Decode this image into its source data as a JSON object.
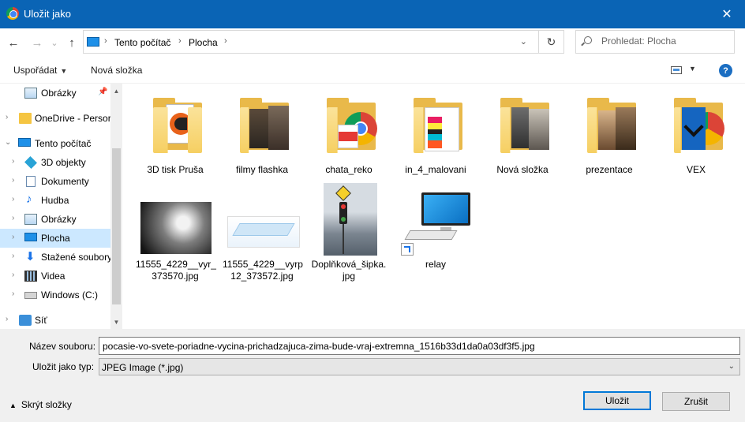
{
  "window": {
    "title": "Uložit jako",
    "close_glyph": "✕"
  },
  "nav": {
    "back_glyph": "←",
    "forward_glyph": "→",
    "recent_glyph": "⌄",
    "up_glyph": "↑",
    "breadcrumb": [
      "Tento počítač",
      "Plocha"
    ],
    "sep_glyph": "›",
    "dropdown_glyph": "⌄",
    "refresh_glyph": "↻"
  },
  "search": {
    "placeholder": "Prohledat: Plocha"
  },
  "toolbar": {
    "organize": "Uspořádat",
    "organize_caret": "▼",
    "new_folder": "Nová složka",
    "view_caret": "▼",
    "help": "?"
  },
  "sidebar": {
    "items": [
      {
        "label": "Obrázky",
        "icon": "pictures-icon",
        "pinned": true,
        "pin_glyph": "📌"
      },
      {
        "label": "OneDrive - Persor",
        "icon": "onedrive-folder-icon",
        "chev": "›"
      },
      {
        "label": "Tento počítač",
        "icon": "computer-icon",
        "chev": "⌄"
      },
      {
        "label": "3D objekty",
        "icon": "3d-objects-icon",
        "chev": "›"
      },
      {
        "label": "Dokumenty",
        "icon": "documents-icon",
        "chev": "›"
      },
      {
        "label": "Hudba",
        "icon": "music-icon",
        "chev": "›",
        "glyph": "♪"
      },
      {
        "label": "Obrázky",
        "icon": "pictures-icon",
        "chev": "›"
      },
      {
        "label": "Plocha",
        "icon": "desktop-icon",
        "chev": "›",
        "selected": true
      },
      {
        "label": "Stažené soubory",
        "icon": "downloads-icon",
        "chev": "›",
        "glyph": "⬇"
      },
      {
        "label": "Videa",
        "icon": "videos-icon",
        "chev": "›"
      },
      {
        "label": "Windows  (C:)",
        "icon": "drive-icon",
        "chev": "›"
      },
      {
        "label": "Síť",
        "icon": "network-icon",
        "chev": "›"
      }
    ],
    "scroll_up": "▲",
    "scroll_down": "▼"
  },
  "files": [
    {
      "name": "3D tisk Pruša",
      "kind": "folder",
      "overlay": "prusa"
    },
    {
      "name": "filmy flashka",
      "kind": "folder",
      "overlay": "photo"
    },
    {
      "name": "chata_reko",
      "kind": "folder",
      "overlay": "pdf-chrome"
    },
    {
      "name": "in_4_malovani",
      "kind": "folder",
      "overlay": "colors"
    },
    {
      "name": "Nová složka",
      "kind": "folder",
      "overlay": "photo-dark"
    },
    {
      "name": "prezentace",
      "kind": "folder",
      "overlay": "photo-warm"
    },
    {
      "name": "VEX",
      "kind": "folder",
      "overlay": "vex-chrome"
    },
    {
      "name": "11555_4229__vyr_373570.jpg",
      "line1": "11555_4229__vyr_",
      "line2": "373570.jpg",
      "kind": "image",
      "overlay": "dark-render"
    },
    {
      "name": "11555_4229__vyrp12_373572.jpg",
      "line1": "11555_4229__vyrp",
      "line2": "12_373572.jpg",
      "kind": "image",
      "overlay": "light-render"
    },
    {
      "name": "Doplňková_šipka.jpg",
      "line1": "Doplňková_šipka.",
      "line2": "jpg",
      "kind": "image",
      "overlay": "traffic"
    },
    {
      "name": "relay",
      "kind": "shortcut",
      "overlay": "computer"
    }
  ],
  "form": {
    "filename_label": "Název souboru:",
    "filename_value": "pocasie-vo-svete-poriadne-vycina-prichadzajuca-zima-bude-vraj-extremna_1516b33d1da0a03df3f5.jpg",
    "type_label": "Uložit jako typ:",
    "type_value": "JPEG Image (*.jpg)",
    "type_arrow": "⌄",
    "hide_folders": "Skrýt složky",
    "hide_glyph": "▲",
    "save": "Uložit",
    "cancel": "Zrušit"
  },
  "colors": {
    "titlebar": "#0a64b5",
    "selection": "#cce8ff",
    "accent": "#0078d7"
  }
}
